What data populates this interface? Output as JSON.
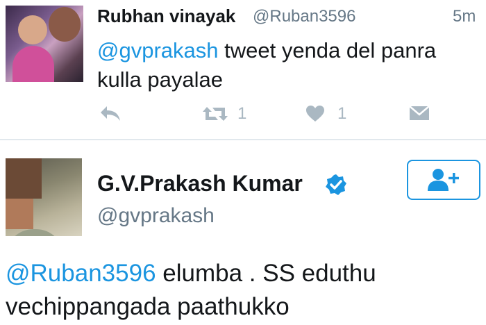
{
  "tweet1": {
    "display_name": "Rubhan vinayak",
    "handle": "@Ruban3596",
    "time": "5m",
    "mention": "@gvprakash",
    "text": " tweet yenda del panra kulla payalae",
    "retweet_count": "1",
    "like_count": "1"
  },
  "tweet2": {
    "display_name": "G.V.Prakash Kumar",
    "handle": "@gvprakash",
    "mention": "@Ruban3596",
    "text": " elumba . SS eduthu vechippangada paathukko"
  },
  "colors": {
    "link_blue": "#1b95e0",
    "muted_gray": "#657786",
    "icon_gray": "#aab8c2"
  },
  "icons": [
    "reply-icon",
    "retweet-icon",
    "heart-icon",
    "direct-message-icon",
    "verified-icon",
    "follow-user-icon"
  ]
}
